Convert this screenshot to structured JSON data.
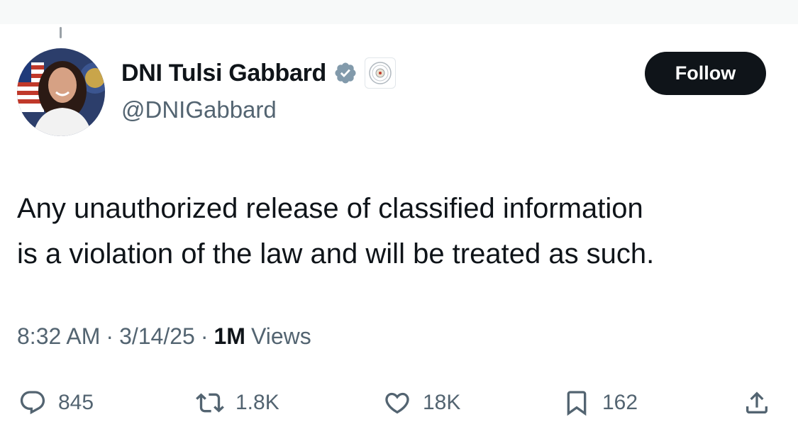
{
  "author": {
    "display_name": "DNI Tulsi Gabbard",
    "handle": "@DNIGabbard",
    "verified": true,
    "verified_color": "#829aab"
  },
  "follow_button": {
    "label": "Follow"
  },
  "tweet": {
    "text_lines": [
      "Any unauthorized release of classified information",
      "is a violation of the law and will be treated as such."
    ]
  },
  "meta": {
    "time": "8:32 AM",
    "date": "3/14/25",
    "views_count": "1M",
    "views_label": "Views",
    "separator": "·"
  },
  "actions": {
    "replies": "845",
    "retweets": "1.8K",
    "likes": "18K",
    "bookmarks": "162"
  },
  "colors": {
    "text_primary": "#0f1419",
    "text_secondary": "#536471",
    "follow_bg": "#0f1419"
  }
}
